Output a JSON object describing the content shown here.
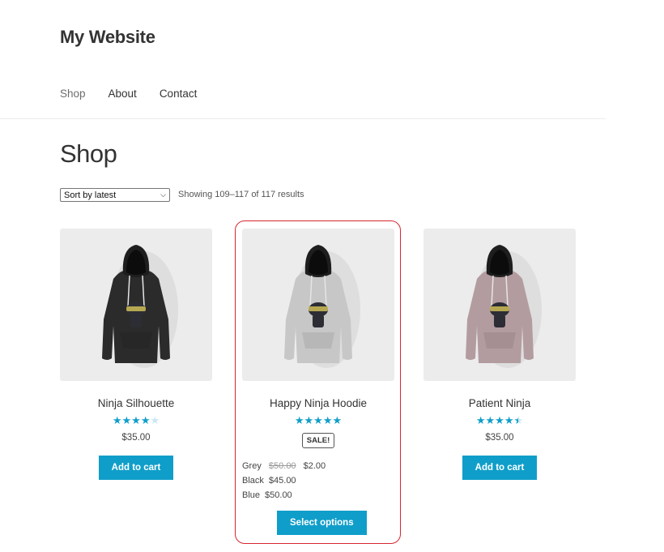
{
  "site": {
    "title": "My Website"
  },
  "nav": {
    "items": [
      "Shop",
      "About",
      "Contact"
    ]
  },
  "page": {
    "title": "Shop"
  },
  "toolbar": {
    "sort_value": "Sort by latest",
    "result_count": "Showing 109–117 of 117 results"
  },
  "products": [
    {
      "name": "Ninja Silhouette",
      "rating": 4,
      "price": "$35.00",
      "button": "Add to cart",
      "hoodie_color": "#2b2b2b"
    },
    {
      "name": "Happy Ninja Hoodie",
      "rating": 5,
      "badge": "SALE!",
      "button": "Select options",
      "hoodie_color": "#c7c7c7",
      "variations": [
        {
          "label": "Grey",
          "old_price": "$50.00",
          "price": "$2.00"
        },
        {
          "label": "Black",
          "price": "$45.00"
        },
        {
          "label": "Blue",
          "price": "$50.00"
        }
      ]
    },
    {
      "name": "Patient Ninja",
      "rating": 4.5,
      "price": "$35.00",
      "button": "Add to cart",
      "hoodie_color": "#b39ca0"
    }
  ],
  "colors": {
    "accent": "#0f9ec9",
    "highlight": "#d7262f"
  }
}
